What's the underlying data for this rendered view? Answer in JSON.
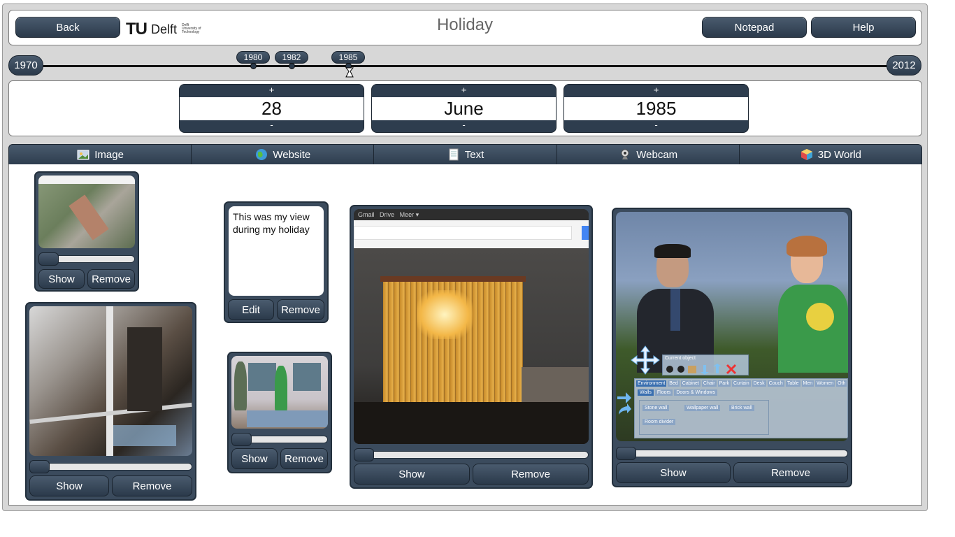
{
  "header": {
    "back_label": "Back",
    "title": "Holiday",
    "notepad_label": "Notepad",
    "help_label": "Help",
    "logo": {
      "tu": "TU",
      "delft": "Delft",
      "small": "Delft University of Technology"
    }
  },
  "timeline": {
    "start": "1970",
    "end": "2012",
    "marks": [
      "1980",
      "1982",
      "1985"
    ],
    "selected": "1985"
  },
  "date": {
    "plus": "+",
    "minus": "-",
    "day": "28",
    "month": "June",
    "year": "1985"
  },
  "tabs": [
    {
      "label": "Image",
      "icon": "image-icon"
    },
    {
      "label": "Website",
      "icon": "globe-icon"
    },
    {
      "label": "Text",
      "icon": "notepad-icon"
    },
    {
      "label": "Webcam",
      "icon": "webcam-icon"
    },
    {
      "label": "3D World",
      "icon": "cube-icon"
    }
  ],
  "cards": {
    "show": "Show",
    "remove": "Remove",
    "edit": "Edit",
    "note_text": "This was my view during my holiday",
    "browser": {
      "gmail": "Gmail",
      "drive": "Drive",
      "meer": "Meer ▾"
    },
    "world_ui": {
      "current_object": "Current object",
      "tabs": [
        "Environment",
        "Bed",
        "Cabinet",
        "Chair",
        "Park",
        "Curtain",
        "Desk",
        "Couch",
        "Table",
        "Men",
        "Women",
        "Oth"
      ],
      "subtabs": [
        "Walls",
        "Floors",
        "Doors & Windows"
      ],
      "items": [
        "Stone wall",
        "Wallpaper wall",
        "Brick wall",
        "Room divider"
      ]
    }
  },
  "colors": {
    "button_top": "#4a5b6e",
    "button_bottom": "#2b3a4b",
    "background": "#d7d7d7",
    "logo_accent": "#00a6d6"
  }
}
